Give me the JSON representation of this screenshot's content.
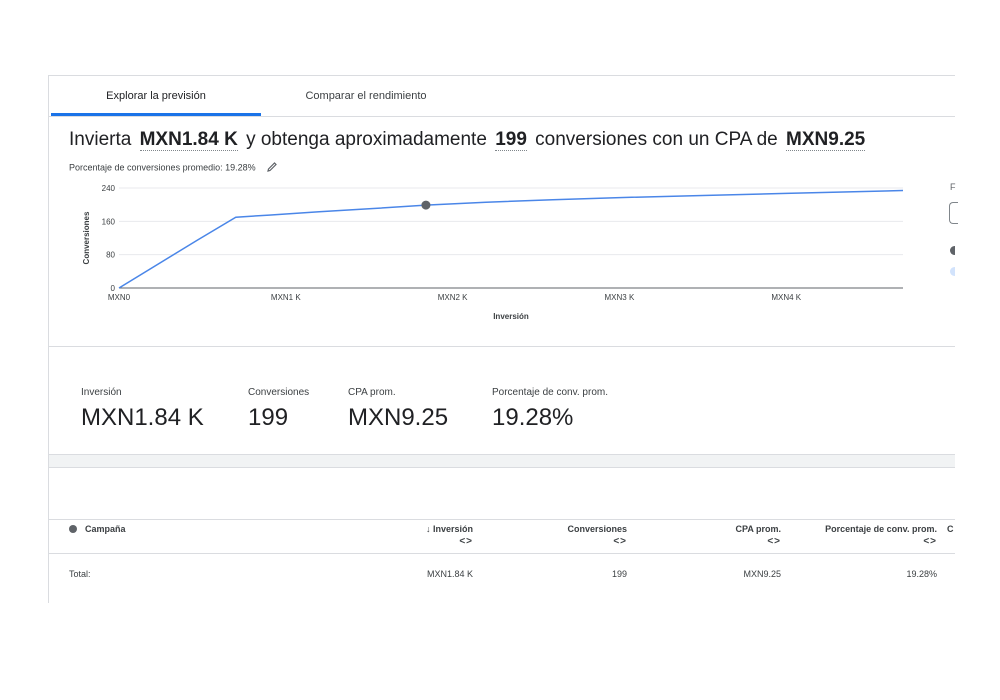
{
  "tabs": [
    {
      "label": "Explorar la previsión",
      "active": true
    },
    {
      "label": "Comparar el rendimiento",
      "active": false
    }
  ],
  "headline": {
    "prefix": "Invierta",
    "investment": "MXN1.84 K",
    "middle": "y obtenga aproximadamente",
    "conversions": "199",
    "suffix": "conversiones con un CPA de",
    "cpa": "MXN9.25"
  },
  "subline": "Porcentaje de conversiones promedio: 19.28%",
  "chart_data": {
    "type": "line",
    "xlabel": "Inversión",
    "ylabel": "Conversiones",
    "xticks": [
      "MXN0",
      "MXN1 K",
      "MXN2 K",
      "MXN3 K",
      "MXN4 K"
    ],
    "yticks": [
      "0",
      "80",
      "160",
      "240"
    ],
    "xlim": [
      0,
      4700
    ],
    "ylim": [
      0,
      240
    ],
    "grid": true,
    "series": [
      {
        "color": "#4a86e8",
        "x": [
          0,
          470,
          700,
          900,
          1200,
          1500,
          1840,
          2200,
          2600,
          3000,
          3500,
          4000,
          4700
        ],
        "y": [
          0,
          115,
          170,
          175,
          183,
          190,
          199,
          206,
          212,
          217,
          222,
          227,
          234
        ]
      }
    ],
    "marker": {
      "x": 1840,
      "y": 199,
      "color": "#5f6368"
    }
  },
  "metrics": [
    {
      "label": "Inversión",
      "value": "MXN1.84 K"
    },
    {
      "label": "Conversiones",
      "value": "199"
    },
    {
      "label": "CPA prom.",
      "value": "MXN9.25"
    },
    {
      "label": "Porcentaje de conv. prom.",
      "value": "19.28%"
    }
  ],
  "table": {
    "headers": {
      "campaign": "Campaña",
      "investment": "Inversión",
      "conversions": "Conversiones",
      "cpa": "CPA prom.",
      "conv_rate": "Porcentaje de conv. prom.",
      "cut": "C"
    },
    "sorter": "<>",
    "total": {
      "label": "Total:",
      "investment": "MXN1.84 K",
      "conversions": "199",
      "cpa": "MXN9.25",
      "conv_rate": "19.28%"
    }
  },
  "edge_glyph": "F"
}
